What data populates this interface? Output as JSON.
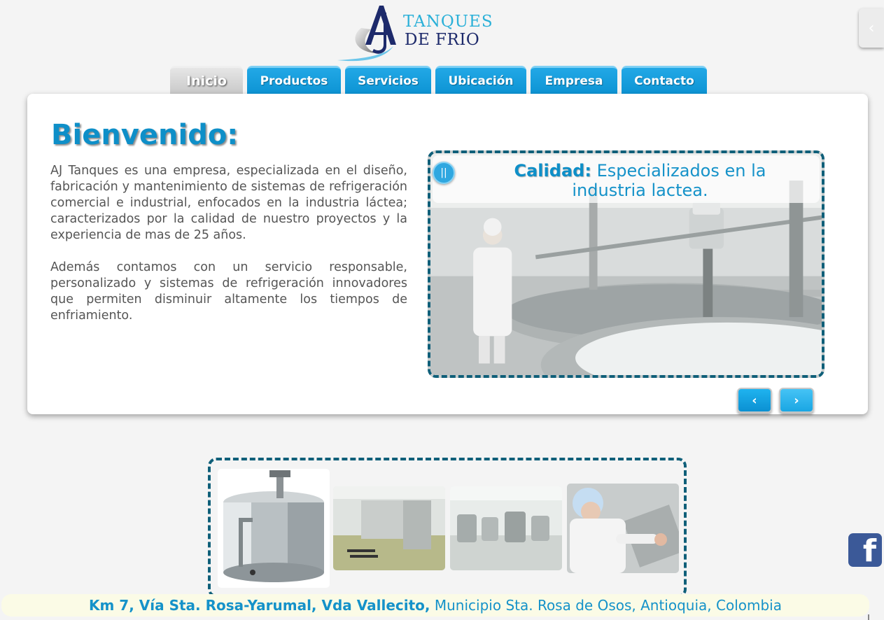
{
  "logo": {
    "line1": "TANQUES",
    "line2": "DE FRIO",
    "mark_letters": "AJ"
  },
  "nav": {
    "tabs": [
      {
        "label": "Inicio",
        "active": true
      },
      {
        "label": "Productos",
        "active": false
      },
      {
        "label": "Servicios",
        "active": false
      },
      {
        "label": "Ubicación",
        "active": false
      },
      {
        "label": "Empresa",
        "active": false
      },
      {
        "label": "Contacto",
        "active": false
      }
    ]
  },
  "side_handle": {
    "icon": "chevron-left-icon",
    "glyph": "‹"
  },
  "main": {
    "title": "Bienvenido:",
    "paragraphs": [
      "AJ Tanques es una empresa, especializada en el diseño, fabricación y mantenimiento de sistemas de refrigeración comercial e industrial, enfocados en la industria láctea; caracterizados por la calidad de nuestro proyectos y la experiencia de mas de 25 años.",
      "Además contamos con un servicio responsable, personalizado y sistemas de refrigeración innovadores que permiten disminuir altamente los tiempos de enfriamiento."
    ]
  },
  "slider": {
    "caption_bold": "Calidad:",
    "caption_text": "Especializados en la industria lactea.",
    "pause_glyph": "||",
    "prev_glyph": "‹",
    "next_glyph": "›"
  },
  "footer": {
    "address_bold": "Km 7, Vía Sta. Rosa-Yarumal, Vda Vallecito,",
    "address_rest": "Municipio Sta. Rosa de Osos, Antioquia, Colombia"
  },
  "social": {
    "facebook_glyph": "f"
  },
  "colors": {
    "accent": "#0e8fc8",
    "tab_blue": "#1aa3e2",
    "dashed_border": "#0f5f79",
    "facebook": "#3b5998"
  }
}
